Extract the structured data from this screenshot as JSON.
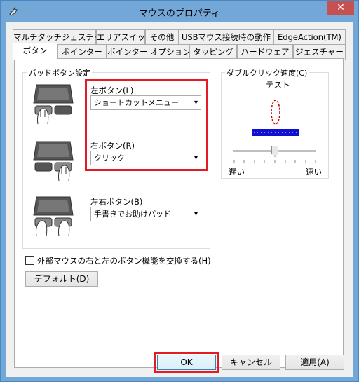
{
  "window": {
    "title": "マウスのプロパティ",
    "close_label": "✕"
  },
  "tabs_row1": [
    {
      "label": "マルチタッチジェスチャー"
    },
    {
      "label": "エリアスイッチ"
    },
    {
      "label": "その他"
    },
    {
      "label": "USBマウス接続時の動作"
    },
    {
      "label": "EdgeAction(TM)"
    }
  ],
  "tabs_row2": [
    {
      "label": "ボタン"
    },
    {
      "label": "ポインター"
    },
    {
      "label": "ポインター オプション"
    },
    {
      "label": "タッピング"
    },
    {
      "label": "ハードウェア"
    },
    {
      "label": "ジェスチャー"
    }
  ],
  "pad_group": {
    "title": "パッドボタン設定",
    "left": {
      "label": "左ボタン(L)",
      "value": "ショートカットメニュー"
    },
    "right": {
      "label": "右ボタン(R)",
      "value": "クリック"
    },
    "both": {
      "label": "左右ボタン(B)",
      "value": "手書きでお助けパッド"
    }
  },
  "double_click": {
    "title": "ダブルクリック速度(C)",
    "test_label": "テスト",
    "slow": "遅い",
    "fast": "速い",
    "speed_fraction": 0.5
  },
  "swap": {
    "label": "外部マウスの右と左のボタン機能を交換する(H)",
    "checked": false
  },
  "default_button": "デフォルト(D)",
  "footer": {
    "ok": "OK",
    "cancel": "キャンセル",
    "apply": "適用(A)"
  },
  "highlight_color": "#e31b23"
}
